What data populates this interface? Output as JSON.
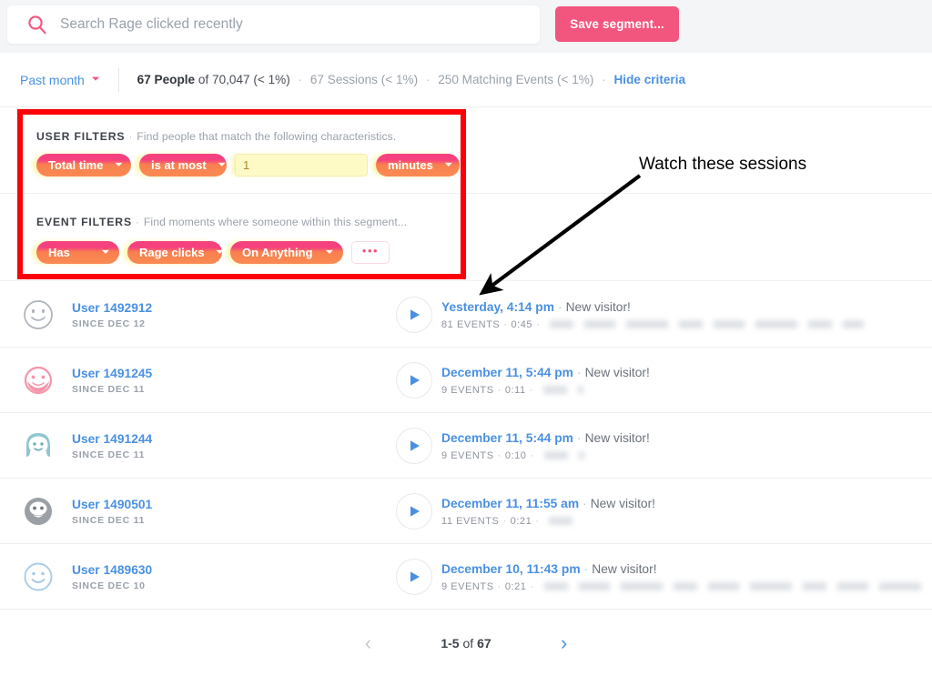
{
  "colors": {
    "accent_pink": "#f2557e",
    "link_blue": "#4a90e2",
    "highlight_red": "#fb0007",
    "pill_gradient_from": "#f6417f",
    "pill_gradient_to": "#fa8a52",
    "topbar_bg": "#f4f5f7",
    "input_yellow": "#fdfac6"
  },
  "topbar": {
    "search_placeholder": "Search Rage clicked recently",
    "search_value": "",
    "search_icon": "search-icon",
    "save_segment_label": "Save segment..."
  },
  "criteria": {
    "date_range_label": "Past month",
    "date_chevron_icon": "chevron-down-icon",
    "people_count": "67 People",
    "people_of": "of 70,047 (< 1%)",
    "sessions": "67 Sessions (< 1%)",
    "matching_events": "250 Matching Events (< 1%)",
    "hide_criteria_label": "Hide criteria",
    "separator": "·"
  },
  "filters": {
    "user": {
      "heading": "USER FILTERS",
      "separator": "·",
      "description": "Find people that match the following characteristics.",
      "property_pill": "Total time",
      "operator_pill": "is at most",
      "value_input": "1",
      "unit_pill": "minutes",
      "chevron_icon": "chevron-down-icon"
    },
    "event": {
      "heading": "EVENT FILTERS",
      "separator": "·",
      "description": "Find moments where someone within this segment...",
      "verb_pill": "Has",
      "event_pill": "Rage clicks",
      "target_pill": "On Anything",
      "more_label": "•••",
      "chevron_icon": "chevron-down-icon"
    }
  },
  "annotation": {
    "text": "Watch these sessions"
  },
  "sessions": [
    {
      "avatar": "avatar-face-outline-gray",
      "user_name": "User 1492912",
      "since": "SINCE DEC 12",
      "when": "Yesterday, 4:14 pm",
      "visitor": "New visitor!",
      "events": "81 EVENTS",
      "duration": "0:45",
      "redacted_width": 345,
      "play_icon": "play-icon"
    },
    {
      "avatar": "avatar-face-pink-beard",
      "user_name": "User 1491245",
      "since": "SINCE DEC 11",
      "when": "December 11, 5:44 pm",
      "visitor": "New visitor!",
      "events": "9 EVENTS",
      "duration": "0:11",
      "redacted_width": 44,
      "play_icon": "play-icon"
    },
    {
      "avatar": "avatar-face-teal-long-hair",
      "user_name": "User 1491244",
      "since": "SINCE DEC 11",
      "when": "December 11, 5:44 pm",
      "visitor": "New visitor!",
      "events": "9 EVENTS",
      "duration": "0:10",
      "redacted_width": 44,
      "play_icon": "play-icon"
    },
    {
      "avatar": "avatar-face-gray-beard-filled",
      "user_name": "User 1490501",
      "since": "SINCE DEC 11",
      "when": "December 11, 11:55 am",
      "visitor": "New visitor!",
      "events": "11 EVENTS",
      "duration": "0:21",
      "redacted_width": 32,
      "play_icon": "play-icon"
    },
    {
      "avatar": "avatar-face-blue-smiley",
      "user_name": "User 1489630",
      "since": "SINCE DEC 10",
      "when": "December 10, 11:43 pm",
      "visitor": "New visitor!",
      "events": "9 EVENTS",
      "duration": "0:21",
      "redacted_width": 420,
      "play_icon": "play-icon"
    }
  ],
  "pagination": {
    "prev_icon": "chevron-left-icon",
    "next_icon": "chevron-right-icon",
    "range_prefix": "1-5",
    "range_of": "of",
    "total": "67"
  }
}
